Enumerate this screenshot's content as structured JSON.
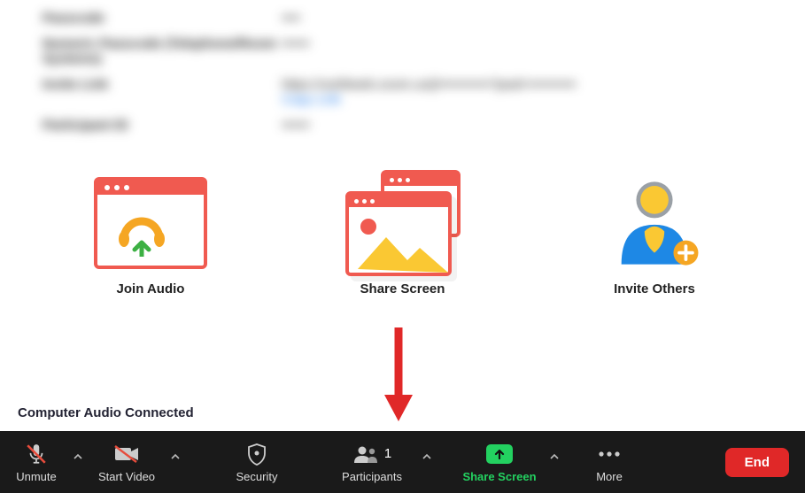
{
  "meeting": {
    "rows": [
      {
        "label": "Passcode",
        "value": "••••"
      },
      {
        "label": "Numeric Passcode (Telephone/Room Systems)",
        "value": "••••••"
      },
      {
        "label": "Invite Link",
        "value": "https://us06web.zoom.us/j/•••••••••••?pwd=••••••••••",
        "link_label": "Copy Link"
      },
      {
        "label": "Participant ID",
        "value": "••••••"
      }
    ]
  },
  "cards": {
    "join_audio": "Join Audio",
    "share_screen": "Share Screen",
    "invite_others": "Invite Others"
  },
  "status_text": "Computer Audio Connected",
  "toolbar": {
    "unmute": "Unmute",
    "start_video": "Start Video",
    "security": "Security",
    "participants": "Participants",
    "participants_count": "1",
    "share_screen": "Share Screen",
    "more": "More",
    "end": "End"
  }
}
